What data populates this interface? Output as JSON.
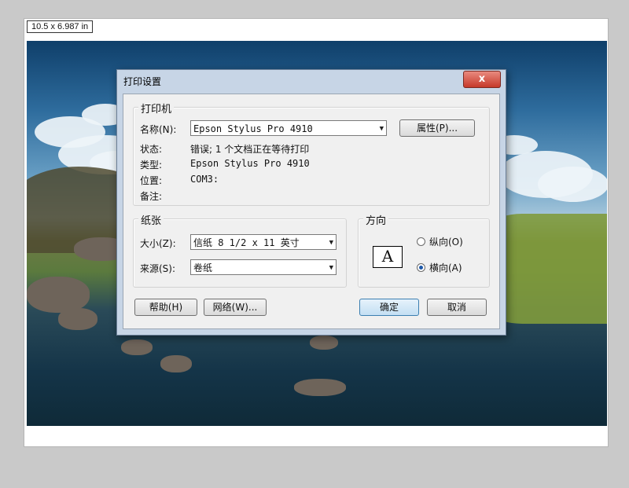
{
  "preview": {
    "size_label": "10.5 x 6.987 in"
  },
  "dialog": {
    "title": "打印设置",
    "close_label": "x",
    "printer_group": {
      "legend": "打印机",
      "name_label": "名称(N):",
      "name_value": "Epson Stylus Pro 4910",
      "properties_button": "属性(P)...",
      "status_label": "状态:",
      "status_value": "错误; 1 个文档正在等待打印",
      "type_label": "类型:",
      "type_value": "Epson Stylus Pro 4910",
      "where_label": "位置:",
      "where_value": "COM3:",
      "comment_label": "备注:"
    },
    "paper_group": {
      "legend": "纸张",
      "size_label": "大小(Z):",
      "size_value": "信纸 8 1/2 x 11 英寸",
      "source_label": "来源(S):",
      "source_value": "卷纸"
    },
    "orientation_group": {
      "legend": "方向",
      "icon_letter": "A",
      "portrait_label": "纵向(O)",
      "landscape_label": "横向(A)",
      "selected": "landscape"
    },
    "buttons": {
      "help": "帮助(H)",
      "network": "网络(W)...",
      "ok": "确定",
      "cancel": "取消"
    }
  }
}
